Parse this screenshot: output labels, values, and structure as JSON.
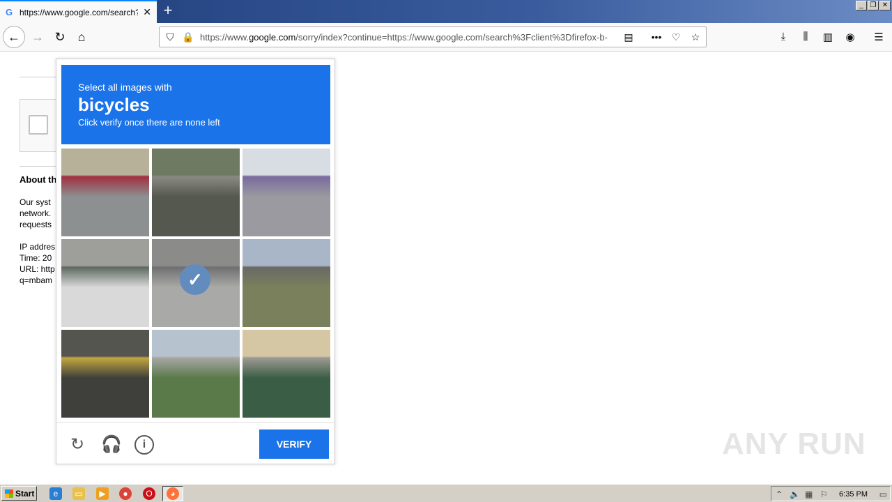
{
  "browser": {
    "tab_title": "https://www.google.com/search?c",
    "tab_favicon": "G",
    "url_prefix": "https://www.",
    "url_domain": "google.com",
    "url_rest": "/sorry/index?continue=https://www.google.com/search%3Fclient%3Dfirefox-b-"
  },
  "page": {
    "about_heading": "About th",
    "sys_lines": [
      "Our syst",
      "network.",
      "requests"
    ],
    "ip_lines": [
      "IP addres",
      "Time: 20",
      "URL: http",
      "q=mbam"
    ]
  },
  "captcha": {
    "line1": "Select all images with",
    "target": "bicycles",
    "line3": "Click verify once there are none left",
    "verify_label": "VERIFY",
    "tiles": [
      {
        "desc": "car on road",
        "selected": false,
        "colors": [
          "#b8b19a",
          "#8c9090",
          "#a23040"
        ]
      },
      {
        "desc": "roadside guardrail",
        "selected": false,
        "colors": [
          "#6f7a63",
          "#55584e",
          "#8a8a85"
        ]
      },
      {
        "desc": "bus",
        "selected": false,
        "colors": [
          "#d8dde4",
          "#9a9aa0",
          "#7a6a9e"
        ]
      },
      {
        "desc": "crosswalk with parked cars",
        "selected": false,
        "colors": [
          "#9e9e9a",
          "#d9d9d9",
          "#5e6a60"
        ]
      },
      {
        "desc": "bicycle on street",
        "selected": true,
        "colors": [
          "#8b8b88",
          "#a9a9a6",
          "#6f7072"
        ]
      },
      {
        "desc": "hillside road",
        "selected": false,
        "colors": [
          "#a9b6c8",
          "#7a7f5c",
          "#6a6a66"
        ]
      },
      {
        "desc": "road with yellow lines",
        "selected": false,
        "colors": [
          "#555550",
          "#3f3f3c",
          "#c2a640"
        ]
      },
      {
        "desc": "parking lot with building",
        "selected": false,
        "colors": [
          "#b7c2cf",
          "#5a7a4a",
          "#a6a6a3"
        ]
      },
      {
        "desc": "bicycles by building",
        "selected": false,
        "colors": [
          "#d6c7a4",
          "#3a5d45",
          "#9c9a92"
        ]
      }
    ]
  },
  "watermark": "ANY RUN",
  "taskbar": {
    "start_label": "Start",
    "clock": "6:35 PM"
  }
}
